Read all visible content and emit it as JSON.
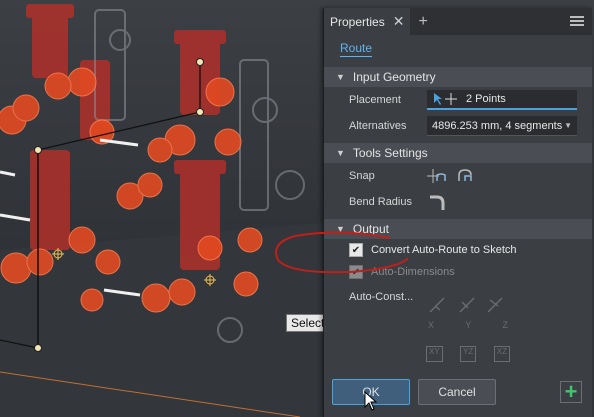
{
  "viewport": {
    "tooltip": "Select"
  },
  "panel": {
    "tab_title": "Properties",
    "route_link": "Route",
    "sections": {
      "input_geometry": "Input Geometry",
      "tools_settings": "Tools Settings",
      "output": "Output"
    },
    "placement": {
      "label": "Placement",
      "value": "2 Points"
    },
    "alternatives": {
      "label": "Alternatives",
      "value": "4896.253 mm, 4 segments"
    },
    "snap_label": "Snap",
    "bend_radius_label": "Bend Radius",
    "convert_checkbox": {
      "label": "Convert Auto-Route to Sketch",
      "checked": true
    },
    "auto_dimensions_checkbox": {
      "label": "Auto-Dimensions",
      "checked": true,
      "disabled": true
    },
    "auto_const_label": "Auto-Const...",
    "constraint_icon_labels": [
      "X",
      "Y",
      "Z",
      "XY",
      "YZ",
      "XZ"
    ],
    "buttons": {
      "ok": "OK",
      "cancel": "Cancel"
    }
  }
}
